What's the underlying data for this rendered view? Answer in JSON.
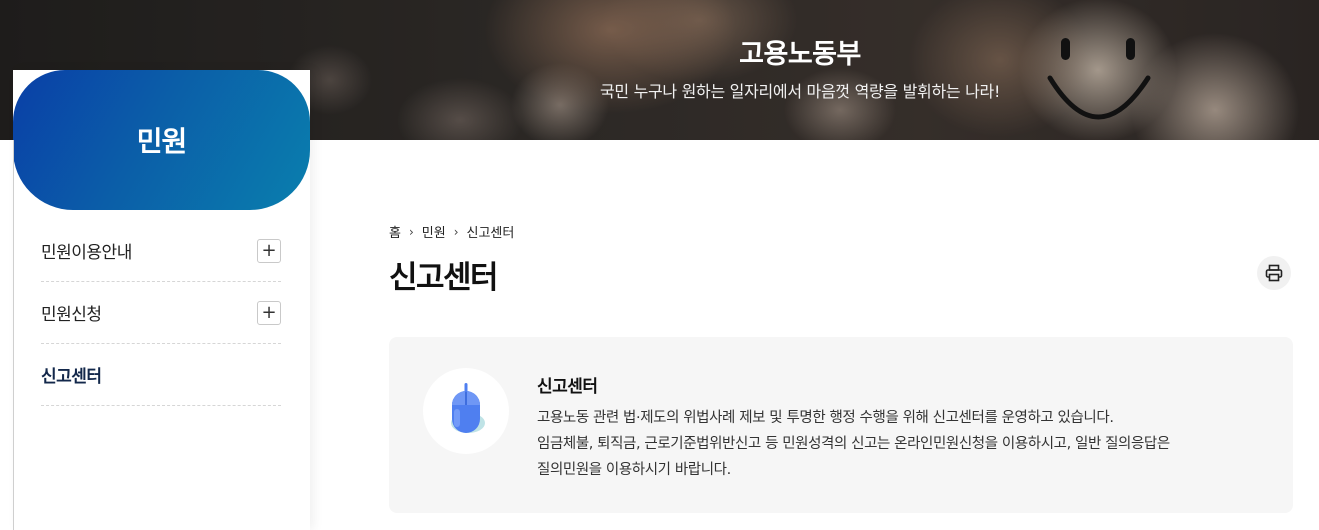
{
  "banner": {
    "title": "고용노동부",
    "subtitle": "국민 누구나 원하는 일자리에서 마음껏 역량을 발휘하는 나라!"
  },
  "sidebar": {
    "title": "민원",
    "items": [
      {
        "label": "민원이용안내",
        "expandable": true,
        "active": false
      },
      {
        "label": "민원신청",
        "expandable": true,
        "active": false
      },
      {
        "label": "신고센터",
        "expandable": false,
        "active": true
      }
    ],
    "expand_symbol": "+"
  },
  "breadcrumb": {
    "items": [
      "홈",
      "민원",
      "신고센터"
    ],
    "separator": "›"
  },
  "page": {
    "title": "신고센터",
    "print_icon": "printer-icon"
  },
  "info": {
    "icon": "mouse-icon",
    "title": "신고센터",
    "lines": [
      "고용노동 관련 법·제도의 위법사례 제보 및 투명한 행정 수행을 위해 신고센터를 운영하고 있습니다.",
      "임금체불, 퇴직금, 근로기준법위반신고 등 민원성격의 신고는 온라인민원신청을 이용하시고, 일반 질의응답은",
      "질의민원을 이용하시기 바랍니다."
    ]
  },
  "colors": {
    "sidebar_gradient_start": "#0a3fa7",
    "sidebar_gradient_end": "#0a7fae",
    "active_menu": "#13284b",
    "info_box_bg": "#f6f6f6"
  }
}
